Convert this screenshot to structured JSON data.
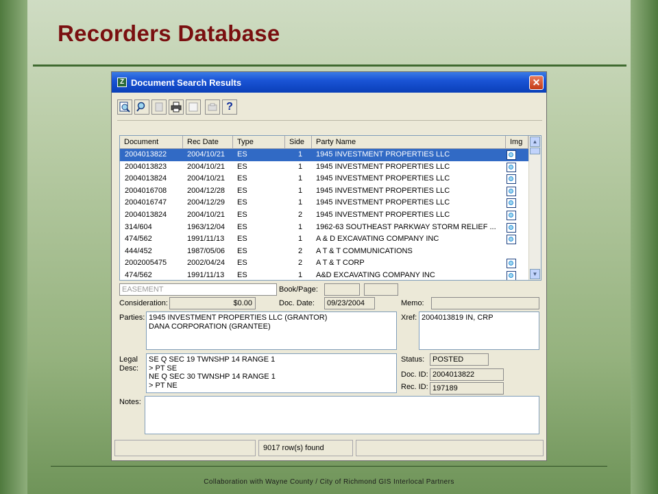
{
  "slide": {
    "title": "Recorders Database",
    "footer": "Collaboration with Wayne County / City of Richmond GIS Interlocal Partners"
  },
  "window": {
    "title": "Document Search Results",
    "close_glyph": "✕",
    "help_glyph": "?"
  },
  "toolbar": {
    "buttons": [
      {
        "icon": "zoom-page-icon",
        "enabled": true
      },
      {
        "icon": "search-icon",
        "enabled": true
      },
      {
        "icon": "document-icon",
        "enabled": false
      },
      {
        "icon": "print-icon",
        "enabled": true
      },
      {
        "icon": "blank-page-icon",
        "enabled": false
      },
      {
        "icon": "scanner-icon",
        "enabled": false
      },
      {
        "icon": "help-icon",
        "enabled": true
      }
    ]
  },
  "grid": {
    "headers": [
      "Document",
      "Rec Date",
      "Type",
      "Side",
      "Party Name",
      "Img"
    ],
    "rows": [
      {
        "document": "2004013822",
        "rec_date": "2004/10/21",
        "type": "ES",
        "side": "1",
        "party": "1945 INVESTMENT PROPERTIES LLC",
        "img": true,
        "selected": true
      },
      {
        "document": "2004013823",
        "rec_date": "2004/10/21",
        "type": "ES",
        "side": "1",
        "party": "1945 INVESTMENT PROPERTIES LLC",
        "img": true
      },
      {
        "document": "2004013824",
        "rec_date": "2004/10/21",
        "type": "ES",
        "side": "1",
        "party": "1945 INVESTMENT PROPERTIES LLC",
        "img": true
      },
      {
        "document": "2004016708",
        "rec_date": "2004/12/28",
        "type": "ES",
        "side": "1",
        "party": "1945 INVESTMENT PROPERTIES LLC",
        "img": true
      },
      {
        "document": "2004016747",
        "rec_date": "2004/12/29",
        "type": "ES",
        "side": "1",
        "party": "1945 INVESTMENT PROPERTIES LLC",
        "img": true
      },
      {
        "document": "2004013824",
        "rec_date": "2004/10/21",
        "type": "ES",
        "side": "2",
        "party": "1945 INVESTMENT PROPERTIES LLC",
        "img": true
      },
      {
        "document": "314/604",
        "rec_date": "1963/12/04",
        "type": "ES",
        "side": "1",
        "party": "1962-63 SOUTHEAST PARKWAY STORM RELIEF ...",
        "img": true
      },
      {
        "document": "474/562",
        "rec_date": "1991/11/13",
        "type": "ES",
        "side": "1",
        "party": "A & D EXCAVATING COMPANY INC",
        "img": true
      },
      {
        "document": "444/452",
        "rec_date": "1987/05/06",
        "type": "ES",
        "side": "2",
        "party": "A T & T COMMUNICATIONS",
        "img": false
      },
      {
        "document": "2002005475",
        "rec_date": "2002/04/24",
        "type": "ES",
        "side": "2",
        "party": "A T & T CORP",
        "img": true
      },
      {
        "document": "474/562",
        "rec_date": "1991/11/13",
        "type": "ES",
        "side": "1",
        "party": "A&D EXCAVATING COMPANY INC",
        "img": true
      }
    ]
  },
  "detail": {
    "doc_type": "EASEMENT",
    "book_page_label": "Book/Page:",
    "book": "",
    "page": "",
    "consideration_label": "Consideration:",
    "consideration": "$0.00",
    "doc_date_label": "Doc. Date:",
    "doc_date": "09/23/2004",
    "memo_label": "Memo:",
    "memo": "",
    "parties_label": "Parties:",
    "parties": [
      "1945 INVESTMENT PROPERTIES LLC (GRANTOR)",
      "DANA CORPORATION (GRANTEE)"
    ],
    "xref_label": "Xref:",
    "xref": "2004013819 IN, CRP",
    "legal_label_1": "Legal",
    "legal_label_2": "Desc:",
    "legal": [
      "SE Q  SEC 19  TWNSHP 14  RANGE 1",
      ">  PT SE",
      "NE Q  SEC 30  TWNSHP 14  RANGE 1",
      ">  PT NE"
    ],
    "status_label": "Status:",
    "status": "POSTED",
    "doc_id_label": "Doc. ID:",
    "doc_id": "2004013822",
    "rec_id_label": "Rec. ID:",
    "rec_id": "197189",
    "notes_label": "Notes:",
    "notes": ""
  },
  "statusbar": {
    "rows_found": "9017 row(s) found"
  }
}
